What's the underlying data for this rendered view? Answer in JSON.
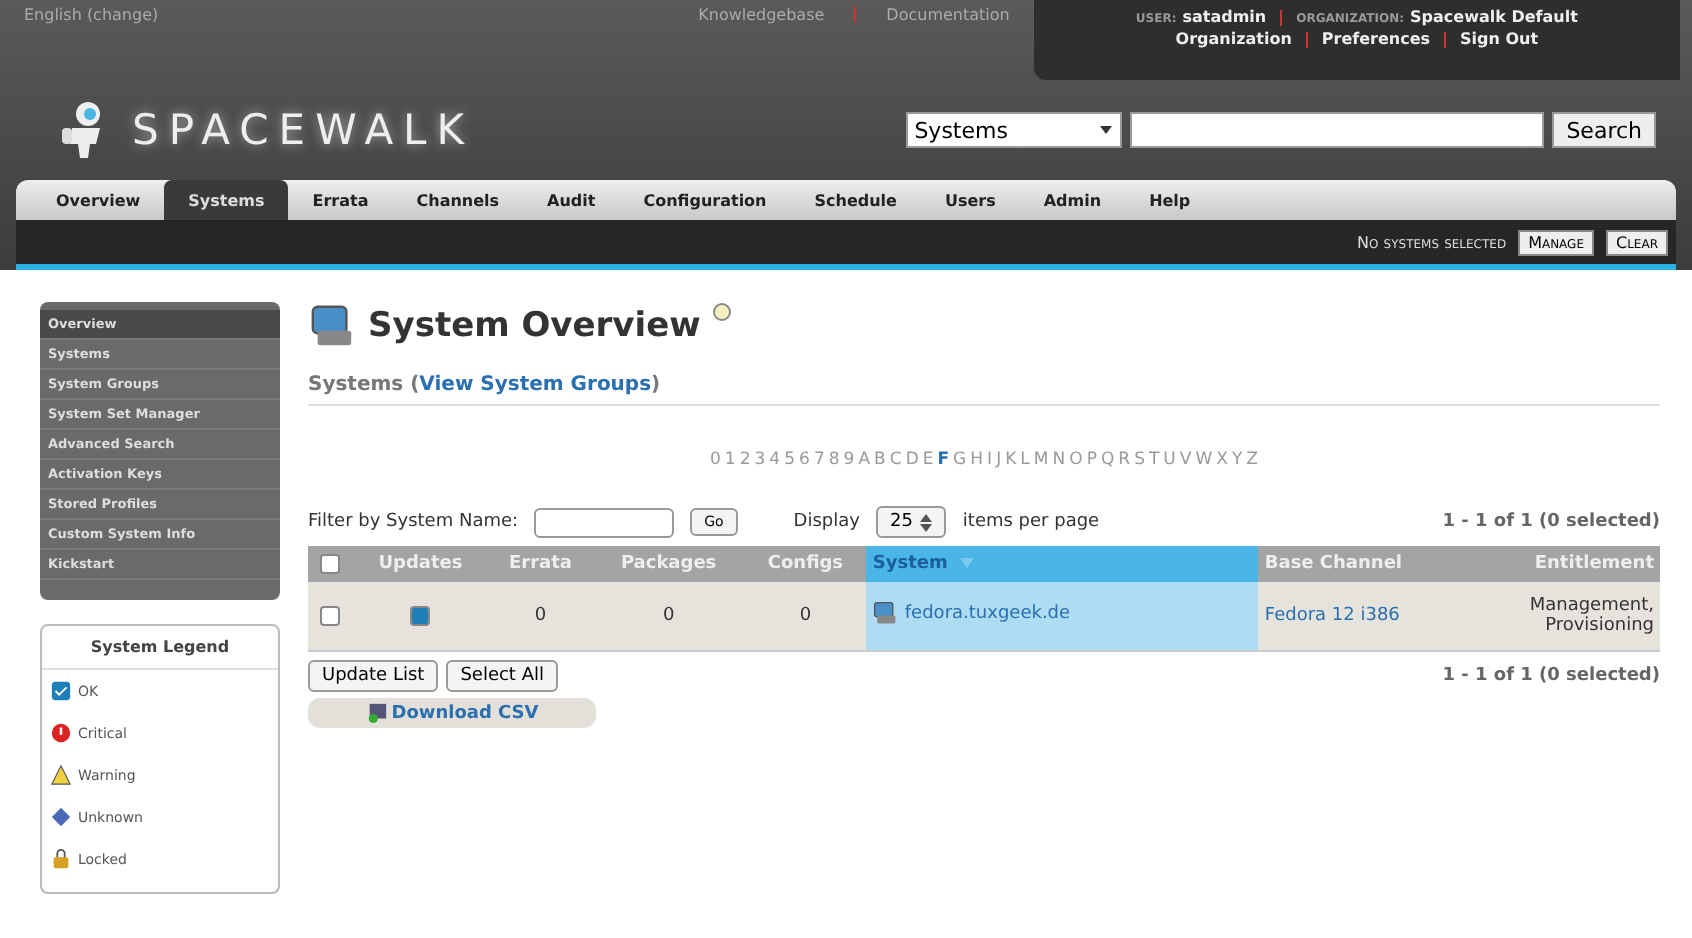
{
  "topbar": {
    "language": "English",
    "change": "(change)",
    "links": [
      "Knowledgebase",
      "Documentation"
    ],
    "user_label": "USER:",
    "user": "satadmin",
    "org_label": "ORGANIZATION:",
    "org": "Spacewalk Default",
    "account_links": [
      "Organization",
      "Preferences",
      "Sign Out"
    ]
  },
  "logo": {
    "text": "SPACEWALK"
  },
  "search": {
    "scope": "Systems",
    "button": "Search"
  },
  "tabs": [
    {
      "label": "Overview",
      "selected": false
    },
    {
      "label": "Systems",
      "selected": true
    },
    {
      "label": "Errata",
      "selected": false
    },
    {
      "label": "Channels",
      "selected": false
    },
    {
      "label": "Audit",
      "selected": false
    },
    {
      "label": "Configuration",
      "selected": false
    },
    {
      "label": "Schedule",
      "selected": false
    },
    {
      "label": "Users",
      "selected": false
    },
    {
      "label": "Admin",
      "selected": false
    },
    {
      "label": "Help",
      "selected": false
    }
  ],
  "selection_bar": {
    "status": "No systems selected",
    "buttons": [
      "Manage",
      "Clear"
    ]
  },
  "sidebar": {
    "items": [
      {
        "label": "Overview",
        "selected": true
      },
      {
        "label": "Systems",
        "selected": false
      },
      {
        "label": "System Groups",
        "selected": false
      },
      {
        "label": "System Set Manager",
        "selected": false
      },
      {
        "label": "Advanced Search",
        "selected": false
      },
      {
        "label": "Activation Keys",
        "selected": false
      },
      {
        "label": "Stored Profiles",
        "selected": false
      },
      {
        "label": "Custom System Info",
        "selected": false
      },
      {
        "label": "Kickstart",
        "selected": false
      }
    ]
  },
  "legend": {
    "title": "System Legend",
    "items": [
      {
        "kind": "ok",
        "label": "OK"
      },
      {
        "kind": "critical",
        "label": "Critical"
      },
      {
        "kind": "warning",
        "label": "Warning"
      },
      {
        "kind": "unknown",
        "label": "Unknown"
      },
      {
        "kind": "locked",
        "label": "Locked"
      }
    ]
  },
  "page": {
    "title": "System Overview",
    "subtitle": "Systems (",
    "subtitle_link": "View System Groups",
    "subtitle_end": ")"
  },
  "alphabet": [
    {
      "label": "0",
      "available": false
    },
    {
      "label": "1",
      "available": false
    },
    {
      "label": "2",
      "available": false
    },
    {
      "label": "3",
      "available": false
    },
    {
      "label": "4",
      "available": false
    },
    {
      "label": "5",
      "available": false
    },
    {
      "label": "6",
      "available": false
    },
    {
      "label": "7",
      "available": false
    },
    {
      "label": "8",
      "available": false
    },
    {
      "label": "9",
      "available": false
    },
    {
      "label": "A",
      "available": false
    },
    {
      "label": "B",
      "available": false
    },
    {
      "label": "C",
      "available": false
    },
    {
      "label": "D",
      "available": false
    },
    {
      "label": "E",
      "available": false
    },
    {
      "label": "F",
      "available": true
    },
    {
      "label": "G",
      "available": false
    },
    {
      "label": "H",
      "available": false
    },
    {
      "label": "I",
      "available": false
    },
    {
      "label": "J",
      "available": false
    },
    {
      "label": "K",
      "available": false
    },
    {
      "label": "L",
      "available": false
    },
    {
      "label": "M",
      "available": false
    },
    {
      "label": "N",
      "available": false
    },
    {
      "label": "O",
      "available": false
    },
    {
      "label": "P",
      "available": false
    },
    {
      "label": "Q",
      "available": false
    },
    {
      "label": "R",
      "available": false
    },
    {
      "label": "S",
      "available": false
    },
    {
      "label": "T",
      "available": false
    },
    {
      "label": "U",
      "available": false
    },
    {
      "label": "V",
      "available": false
    },
    {
      "label": "W",
      "available": false
    },
    {
      "label": "X",
      "available": false
    },
    {
      "label": "Y",
      "available": false
    },
    {
      "label": "Z",
      "available": false
    }
  ],
  "filter": {
    "label": "Filter by System Name:",
    "button": "Go",
    "display_label": "Display",
    "per_page": "25",
    "per_page_suffix": "items per page",
    "count": "1 - 1 of 1 (0 selected)"
  },
  "table": {
    "columns": [
      "Updates",
      "Errata",
      "Packages",
      "Configs",
      "System",
      "Base Channel",
      "Entitlement"
    ],
    "rows": [
      {
        "checked": false,
        "updates_ok": true,
        "errata": "0",
        "packages": "0",
        "configs": "0",
        "system": "fedora.tuxgeek.de",
        "base_channel": "Fedora 12 i386",
        "entitlement": [
          "Management,",
          "Provisioning"
        ]
      }
    ],
    "all_checked": false
  },
  "actions": {
    "buttons": [
      "Update List",
      "Select All"
    ],
    "count": "1 - 1 of 1 (0 selected)",
    "download": "Download CSV"
  }
}
